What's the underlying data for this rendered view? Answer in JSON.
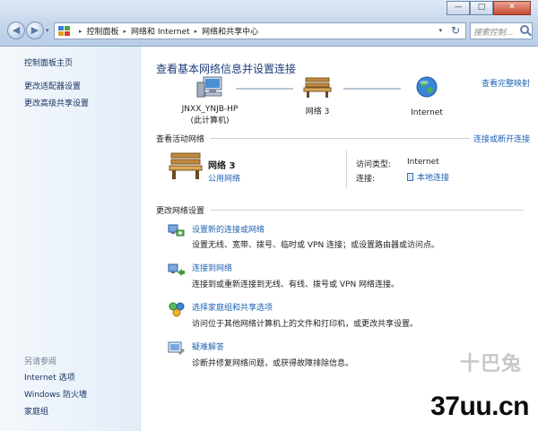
{
  "window": {
    "controls": {
      "minimize": "—",
      "maximize": "□",
      "close": "✕"
    }
  },
  "nav": {
    "back": "◀",
    "forward": "▶",
    "dropdown": "▾"
  },
  "address": {
    "breadcrumbs": [
      "控制面板",
      "网络和 Internet",
      "网络和共享中心"
    ],
    "separator": "▸",
    "dropdown": "▾",
    "refresh": "↻"
  },
  "search": {
    "placeholder": "搜索控制..."
  },
  "sidebar": {
    "links": [
      "控制面板主页",
      "更改适配器设置",
      "更改高级共享设置"
    ],
    "see_also_title": "另请参阅",
    "see_also": [
      "Internet 选项",
      "Windows 防火墙",
      "家庭组"
    ]
  },
  "main": {
    "title": "查看基本网络信息并设置连接",
    "full_map_link": "查看完整映射",
    "map": {
      "computer_name": "JNXX_YNJB-HP",
      "computer_note": "(此计算机)",
      "network_name": "网络  3",
      "internet_label": "Internet"
    },
    "active_networks": {
      "header": "查看活动网络",
      "connect_link": "连接或断开连接",
      "network_name": "网络  3",
      "network_type": "公用网络",
      "access_type_label": "访问类型:",
      "access_type_value": "Internet",
      "connections_label": "连接:",
      "connections_value": "本地连接"
    },
    "change_settings": {
      "header": "更改网络设置",
      "tasks": [
        {
          "icon": "new-connection-icon",
          "title": "设置新的连接或网络",
          "desc": "设置无线、宽带、拨号、临时或 VPN 连接；或设置路由器或访问点。"
        },
        {
          "icon": "connect-network-icon",
          "title": "连接到网络",
          "desc": "连接到或重新连接到无线、有线、拨号或 VPN 网络连接。"
        },
        {
          "icon": "homegroup-icon",
          "title": "选择家庭组和共享选项",
          "desc": "访问位于其他网络计算机上的文件和打印机，或更改共享设置。"
        },
        {
          "icon": "troubleshoot-icon",
          "title": "疑难解答",
          "desc": "诊断并修复网络问题，或获得故障排除信息。"
        }
      ]
    }
  },
  "watermark": {
    "small": "十巴兔",
    "big": "37uu.cn"
  }
}
